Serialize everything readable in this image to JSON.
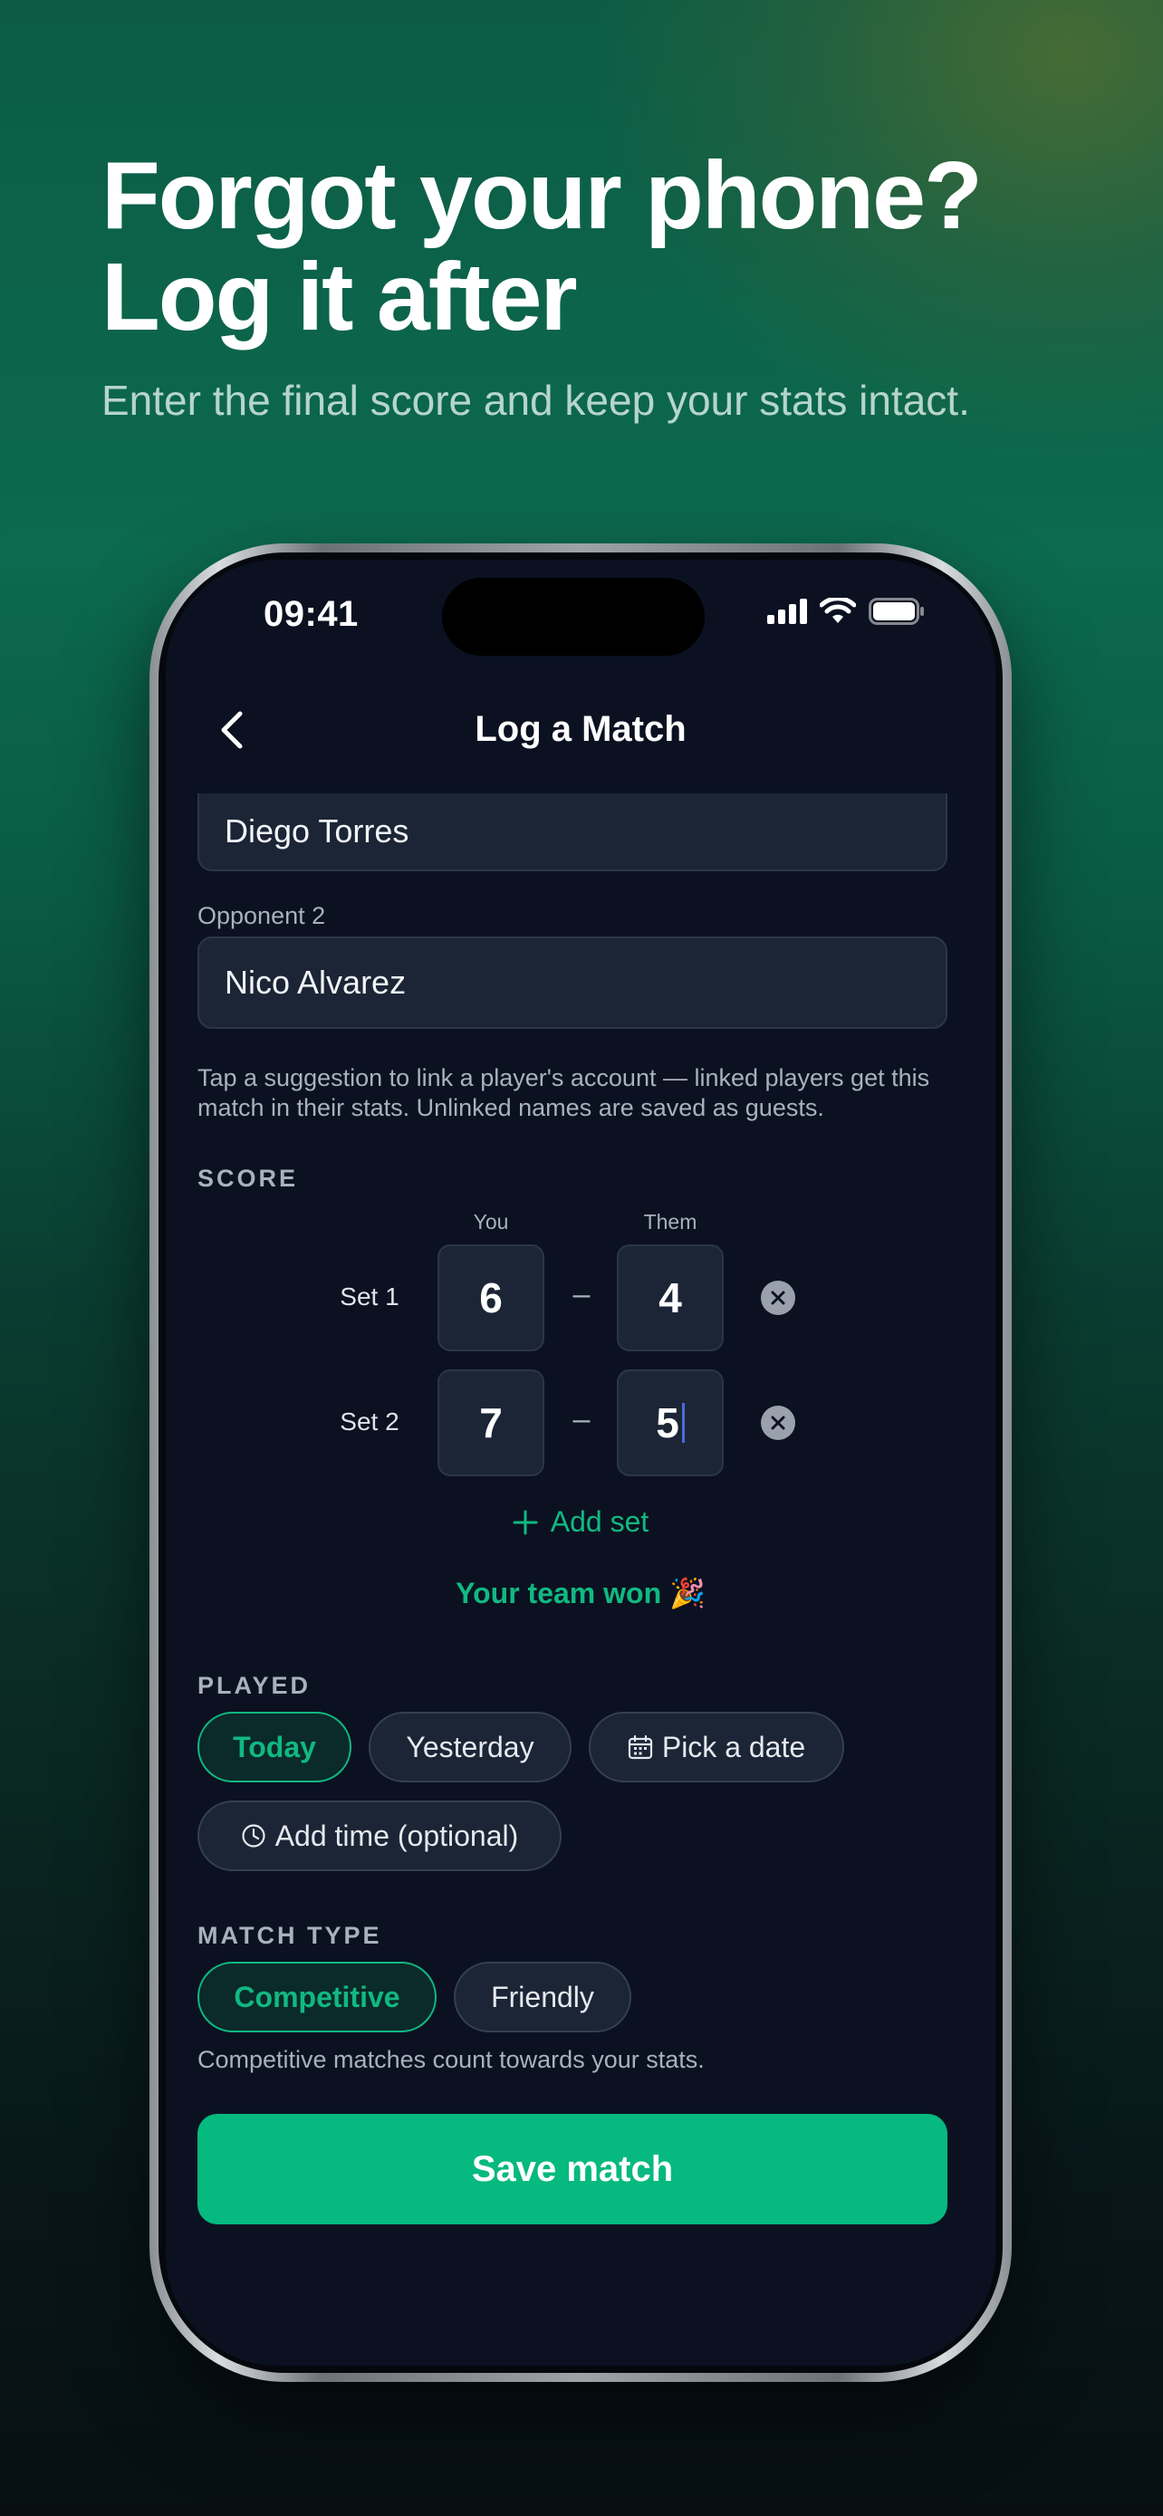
{
  "hero": {
    "headline_line1": "Forgot your phone?",
    "headline_line2": "Log it after",
    "subhead": "Enter the final score and keep your stats intact."
  },
  "status_bar": {
    "time": "09:41",
    "icons": [
      "signal-bars-icon",
      "wifi-icon",
      "battery-icon"
    ]
  },
  "nav": {
    "back_icon": "chevron-left-icon",
    "title": "Log a Match"
  },
  "form": {
    "opponent1_value": "Diego Torres",
    "opponent2_label": "Opponent 2",
    "opponent2_value": "Nico Alvarez",
    "help_text": "Tap a suggestion to link a player's account — linked players get this match in their stats. Unlinked names are saved as guests."
  },
  "score": {
    "section_label": "SCORE",
    "col_you": "You",
    "col_them": "Them",
    "dash": "–",
    "sets": [
      {
        "label": "Set 1",
        "you": "6",
        "them": "4"
      },
      {
        "label": "Set 2",
        "you": "7",
        "them": "5"
      }
    ],
    "add_set_label": "Add set",
    "result": "Your team won 🎉"
  },
  "played": {
    "section_label": "PLAYED",
    "options": [
      "Today",
      "Yesterday",
      "Pick a date"
    ],
    "selected": "Today",
    "add_time_label": "Add time (optional)"
  },
  "match_type": {
    "section_label": "MATCH TYPE",
    "options": [
      "Competitive",
      "Friendly"
    ],
    "selected": "Competitive",
    "note": "Competitive matches count towards your stats."
  },
  "save_label": "Save match",
  "colors": {
    "accent": "#10b981",
    "button": "#06b97f",
    "screen_bg": "#0b1121",
    "field_bg": "#1b2536"
  }
}
